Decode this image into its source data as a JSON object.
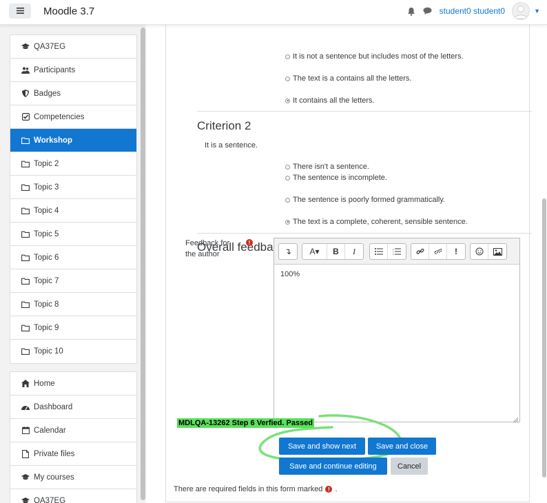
{
  "navbar": {
    "brand": "Moodle 3.7",
    "user_name": "student0 student0",
    "colors": {
      "link": "#1177d1"
    }
  },
  "sidebar": {
    "course_items": [
      {
        "label": "QA37EG",
        "icon": "graduation-cap-icon"
      },
      {
        "label": "Participants",
        "icon": "users-icon"
      },
      {
        "label": "Badges",
        "icon": "shield-icon"
      },
      {
        "label": "Competencies",
        "icon": "check-square-icon"
      },
      {
        "label": "Workshop",
        "icon": "folder-icon",
        "active": true
      },
      {
        "label": "Topic 2",
        "icon": "folder-icon"
      },
      {
        "label": "Topic 3",
        "icon": "folder-icon"
      },
      {
        "label": "Topic 4",
        "icon": "folder-icon"
      },
      {
        "label": "Topic 5",
        "icon": "folder-icon"
      },
      {
        "label": "Topic 6",
        "icon": "folder-icon"
      },
      {
        "label": "Topic 7",
        "icon": "folder-icon"
      },
      {
        "label": "Topic 8",
        "icon": "folder-icon"
      },
      {
        "label": "Topic 9",
        "icon": "folder-icon"
      },
      {
        "label": "Topic 10",
        "icon": "folder-icon"
      }
    ],
    "site_items": [
      {
        "label": "Home",
        "icon": "home-icon"
      },
      {
        "label": "Dashboard",
        "icon": "dashboard-icon"
      },
      {
        "label": "Calendar",
        "icon": "calendar-icon"
      },
      {
        "label": "Private files",
        "icon": "file-icon"
      },
      {
        "label": "My courses",
        "icon": "graduation-cap-icon"
      },
      {
        "label": "QA37EG",
        "icon": "graduation-cap-icon"
      }
    ]
  },
  "criterion1": {
    "options": [
      {
        "label": "It is not a sentence but includes most of the letters.",
        "checked": false
      },
      {
        "label": "The text is a contains all the letters.",
        "checked": false
      },
      {
        "label": "It contains all the letters.",
        "checked": true
      }
    ]
  },
  "criterion2": {
    "title": "Criterion 2",
    "description": "It is a sentence.",
    "options": [
      {
        "label": "There isn't a sentence.",
        "checked": false
      },
      {
        "label": "The sentence is incomplete.",
        "checked": false
      },
      {
        "label": "The sentence is poorly formed grammatically.",
        "checked": false
      },
      {
        "label": "The text is a complete, coherent, sensible sentence.",
        "checked": true
      }
    ]
  },
  "overall": {
    "title": "Overall feedback",
    "feedback_label": "Feedback for the author",
    "editor_text": "100%"
  },
  "buttons": {
    "save_show_next": "Save and show next",
    "save_close": "Save and close",
    "save_continue": "Save and continue editing",
    "cancel": "Cancel"
  },
  "annotation": "MDLQA-13262 Step 6 Verfied. Passed",
  "required_note": "There are required fields in this form marked",
  "required_note_end": "."
}
